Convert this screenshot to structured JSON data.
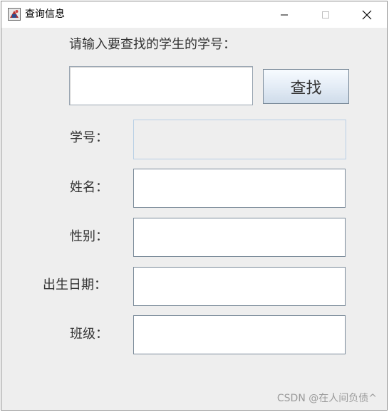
{
  "window": {
    "title": "查询信息",
    "controls": {
      "minimize_icon": "minimize-icon",
      "maximize_icon": "maximize-icon",
      "close_icon": "close-icon"
    }
  },
  "search": {
    "prompt": "请输入要查找的学生的学号：",
    "input_value": "",
    "button_label": "查找"
  },
  "fields": {
    "student_id": {
      "label": "学号：",
      "value": "",
      "enabled": false
    },
    "name": {
      "label": "姓名：",
      "value": ""
    },
    "gender": {
      "label": "性别：",
      "value": ""
    },
    "birth_date": {
      "label": "出生日期：",
      "value": ""
    },
    "class": {
      "label": "班级：",
      "value": ""
    }
  },
  "watermark": "CSDN @在人间负债^",
  "colors": {
    "window_background": "#eeeeee",
    "titlebar_background": "#ffffff",
    "field_border": "#7a8a99",
    "disabled_field_border": "#b8cfe5",
    "button_gradient_top": "#f7fbff",
    "button_gradient_bottom": "#cfdcea"
  }
}
